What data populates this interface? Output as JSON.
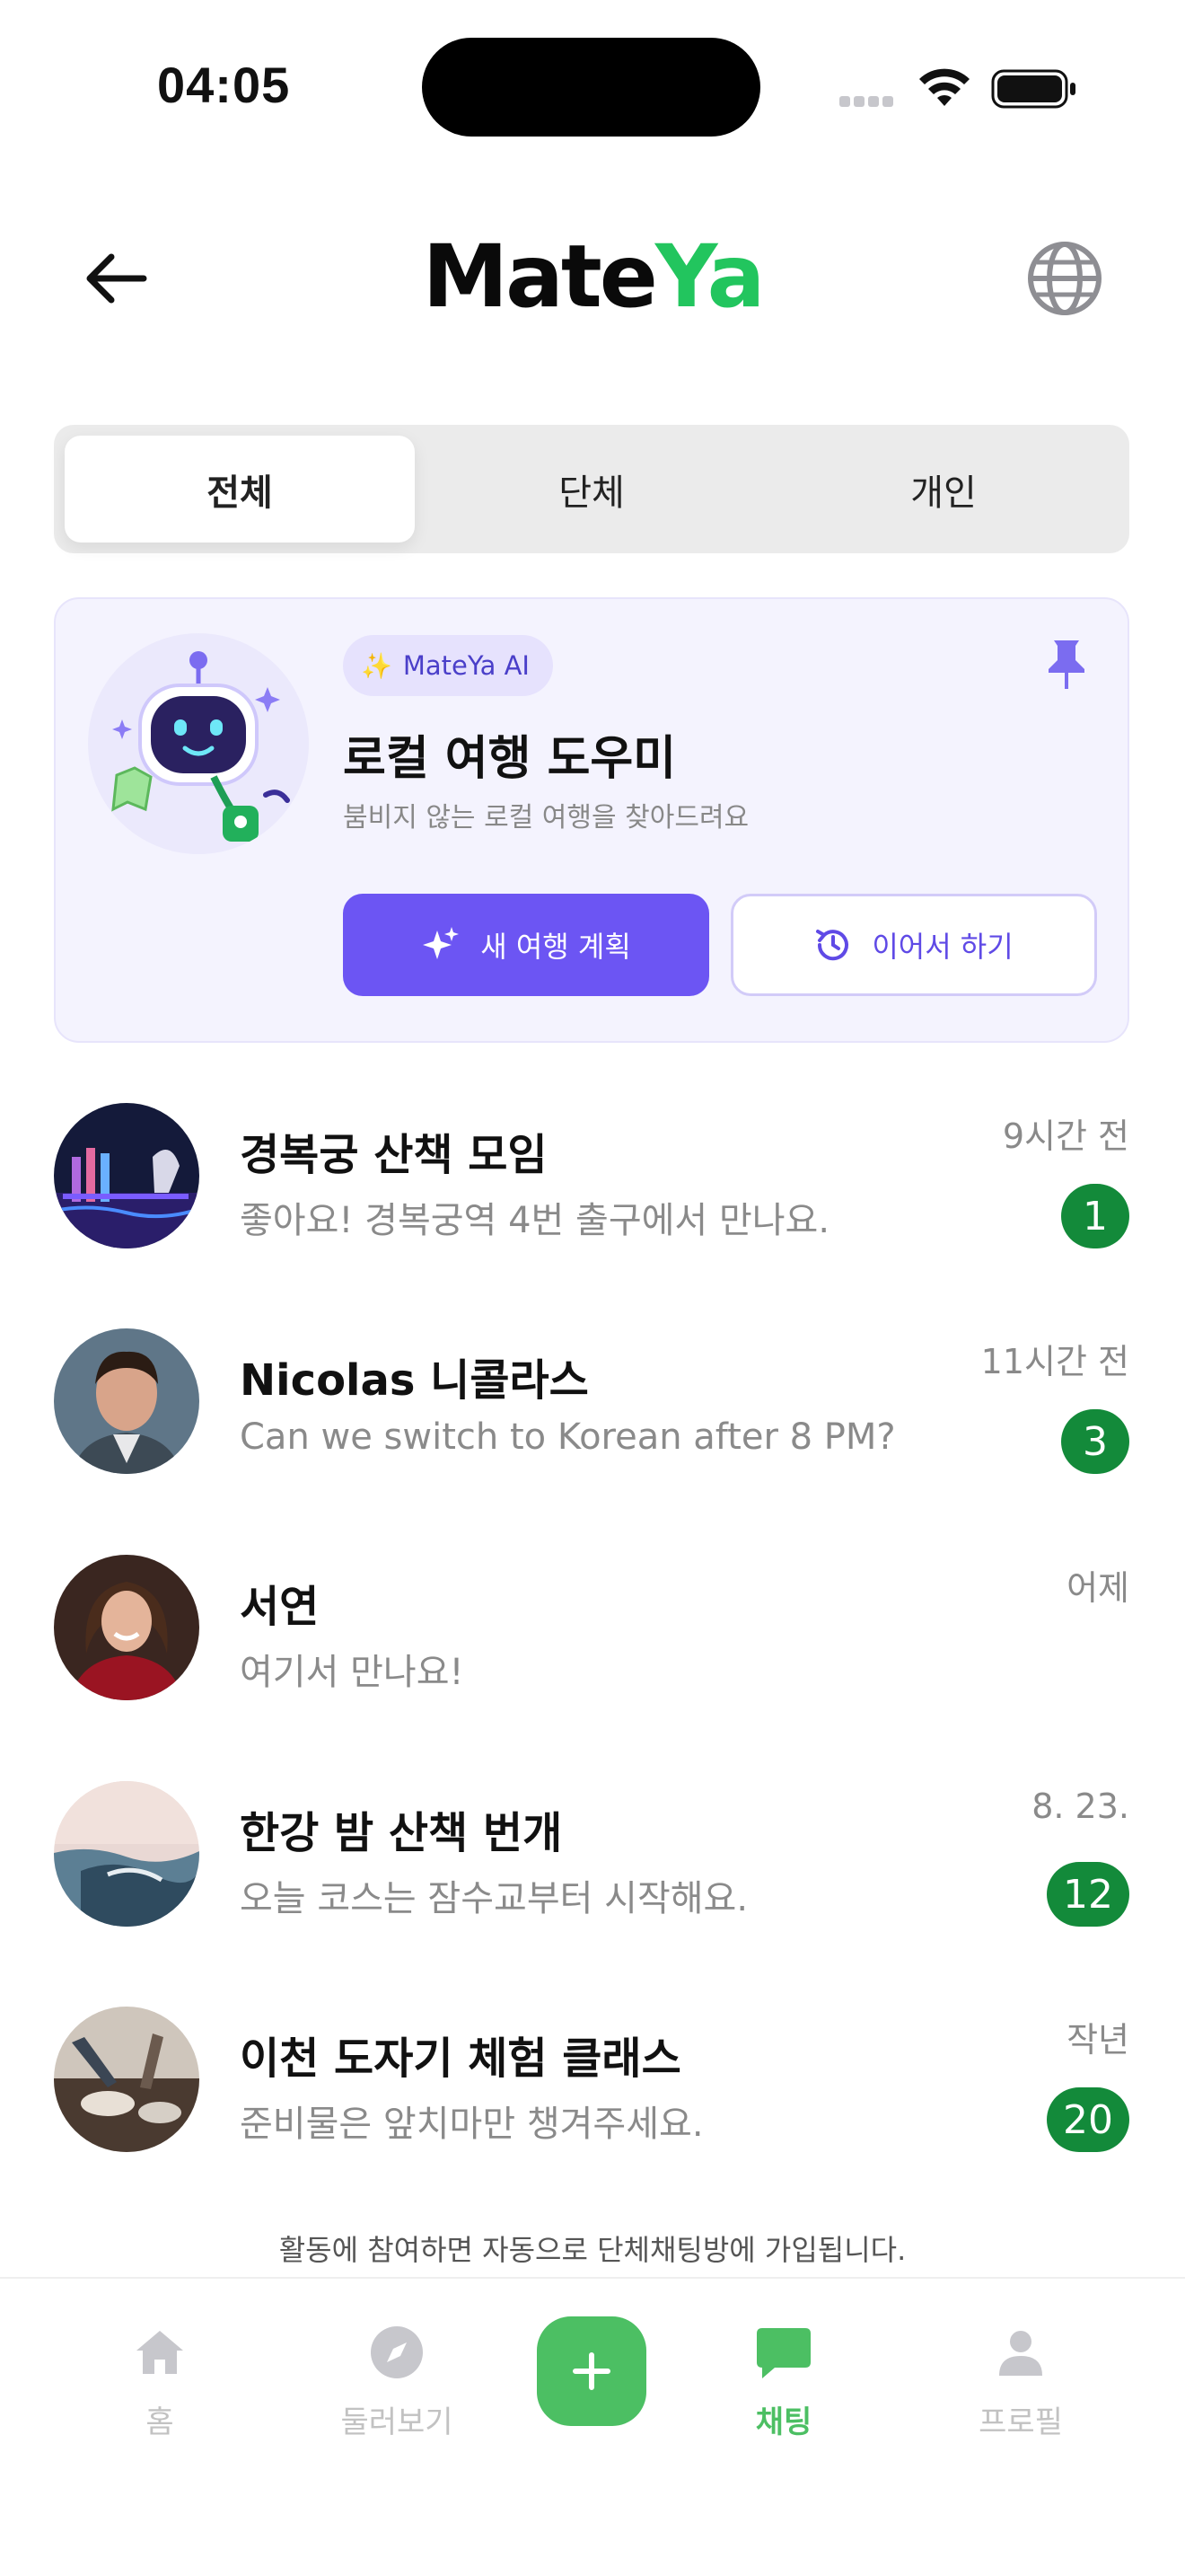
{
  "status_bar": {
    "time": "04:05"
  },
  "header": {
    "logo_mate": "Mate",
    "logo_ya": "Ya"
  },
  "segments": [
    {
      "label": "전체",
      "active": true
    },
    {
      "label": "단체",
      "active": false
    },
    {
      "label": "개인",
      "active": false
    }
  ],
  "ai_card": {
    "badge": "MateYa AI",
    "title": "로컬 여행 도우미",
    "subtitle": "붐비지 않는 로컬 여행을 찾아드려요",
    "new_plan_label": "새 여행 계획",
    "continue_label": "이어서 하기"
  },
  "chats": [
    {
      "name": "경복궁 산책 모임",
      "message": "좋아요! 경복궁역 4번 출구에서 만나요.",
      "time": "9시간 전",
      "unread": "1"
    },
    {
      "name": "Nicolas 니콜라스",
      "message": "Can we switch to Korean after 8 PM?",
      "time": "11시간 전",
      "unread": "3"
    },
    {
      "name": "서연",
      "message": "여기서 만나요!",
      "time": "어제",
      "unread": ""
    },
    {
      "name": "한강 밤 산책 번개",
      "message": "오늘 코스는 잠수교부터 시작해요.",
      "time": "8. 23.",
      "unread": "12"
    },
    {
      "name": "이천 도자기 체험 클래스",
      "message": "준비물은 앞치마만 챙겨주세요.",
      "time": "작년",
      "unread": "20"
    }
  ],
  "footer_note": "활동에 참여하면 자동으로 단체채팅방에 가입됩니다.",
  "bottom_nav": {
    "home": "홈",
    "explore": "둘러보기",
    "chat": "채팅",
    "profile": "프로필"
  },
  "colors": {
    "brand_green": "#22c55e",
    "accent_purple": "#6c55f3",
    "badge_green": "#138a3a"
  }
}
